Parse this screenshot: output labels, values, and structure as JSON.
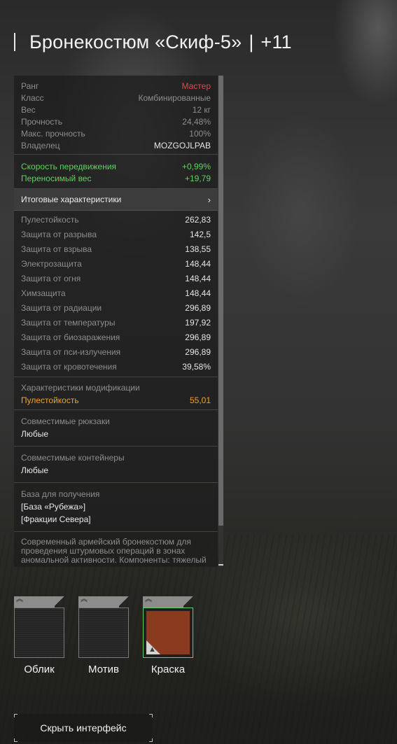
{
  "item": {
    "name": "Бронекостюм «Скиф-5»",
    "separator": "|",
    "upgrade": "+11"
  },
  "info": [
    {
      "label": "Ранг",
      "value": "Мастер",
      "style": "red"
    },
    {
      "label": "Класс",
      "value": "Комбинированные",
      "style": "dim"
    },
    {
      "label": "Вес",
      "value": "12 кг",
      "style": "dim"
    },
    {
      "label": "Прочность",
      "value": "24,48%",
      "style": "dim"
    },
    {
      "label": "Макс. прочность",
      "value": "100%",
      "style": "dim"
    },
    {
      "label": "Владелец",
      "value": "MOZGOJLPAB",
      "style": "normal"
    }
  ],
  "bonuses": [
    {
      "label": "Скорость передвижения",
      "value": "+0,99%"
    },
    {
      "label": "Переносимый вес",
      "value": "+19,79"
    }
  ],
  "summary": {
    "label": "Итоговые характеристики",
    "chevron": "›"
  },
  "stats": [
    {
      "label": "Пулестойкость",
      "value": "262,83"
    },
    {
      "label": "Защита от разрыва",
      "value": "142,5"
    },
    {
      "label": "Защита от взрыва",
      "value": "138,55"
    },
    {
      "label": "Электрозащита",
      "value": "148,44"
    },
    {
      "label": "Защита от огня",
      "value": "148,44"
    },
    {
      "label": "Химзащита",
      "value": "148,44"
    },
    {
      "label": "Защита от радиации",
      "value": "296,89"
    },
    {
      "label": "Защита от температуры",
      "value": "197,92"
    },
    {
      "label": "Защита от биозаражения",
      "value": "296,89"
    },
    {
      "label": "Защита от пси-излучения",
      "value": "296,89"
    },
    {
      "label": "Защита от кровотечения",
      "value": "39,58%"
    }
  ],
  "modification": {
    "title": "Характеристики модификации",
    "label": "Пулестойкость",
    "value": "55,01"
  },
  "backpacks": {
    "title": "Совместимые рюкзаки",
    "value": "Любые"
  },
  "containers": {
    "title": "Совместимые контейнеры",
    "value": "Любые"
  },
  "base": {
    "title": "База для получения",
    "lines": [
      "[База «Рубежа»]",
      "[Фракции Севера]"
    ]
  },
  "description": {
    "line1": "Современный армейский бронекостюм для",
    "line2": "проведения штурмовых операций в зонах",
    "line3": "аномальной активности. Компоненты: тяжелый"
  },
  "slots": [
    {
      "label": "Облик",
      "icon": "double-chevron-up-icon"
    },
    {
      "label": "Мотив",
      "icon": "double-chevron-up-icon"
    },
    {
      "label": "Краска",
      "icon": "double-chevron-up-icon",
      "color": "#8a3a1e",
      "accent": "#5fcf6a"
    }
  ],
  "hide_button": {
    "label": "Скрыть интерфейс"
  },
  "colors": {
    "rank": "#e0484f",
    "bonus": "#5fd25f",
    "modification": "#f0a12c"
  }
}
